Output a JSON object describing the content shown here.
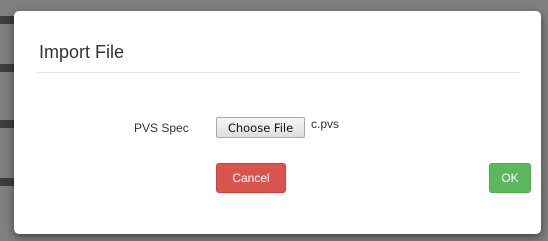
{
  "dialog": {
    "title": "Import File",
    "field_label": "PVS Spec",
    "file_button_label": "Choose File",
    "file_name": "c.pvs",
    "cancel_label": "Cancel",
    "ok_label": "OK"
  },
  "colors": {
    "cancel": "#d9534f",
    "ok": "#5cb85c",
    "backdrop": "#808080"
  }
}
